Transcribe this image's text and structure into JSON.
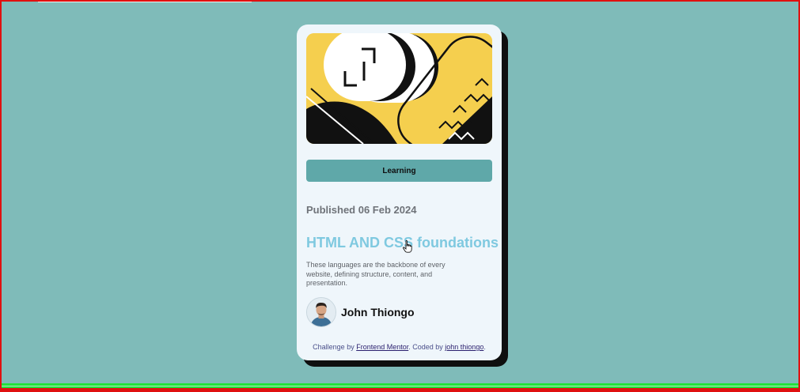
{
  "card": {
    "tag": "Learning",
    "published": "Published 06 Feb 2024",
    "title": "HTML AND CSS foundations",
    "description": "These languages are the backbone of every website, defining structure, content, and presentation.",
    "author": {
      "name": "John Thiongo"
    },
    "attribution": {
      "prefix": "Challenge by ",
      "link1": "Frontend Mentor",
      "middle": ". Coded by ",
      "link2": "john thiongo",
      "suffix": "."
    }
  },
  "colors": {
    "background": "#7fbbb9",
    "card": "#eff6fb",
    "tag": "#5fa8a9",
    "title": "#7fc9e0",
    "hero_yellow": "#f5cf4e",
    "shadow": "#0f0f0f"
  },
  "icons": {
    "cursor": "hand-pointer-icon"
  }
}
